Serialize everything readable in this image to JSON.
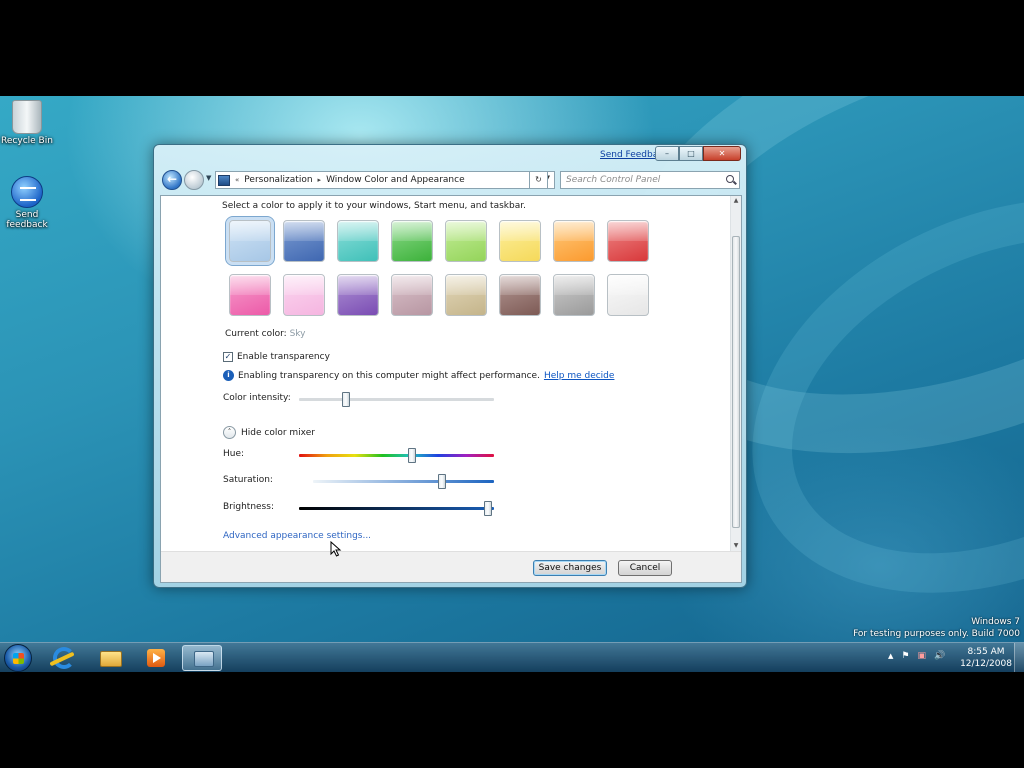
{
  "desktop": {
    "icons": [
      {
        "label": "Recycle Bin",
        "icon": "recycle-bin-icon"
      },
      {
        "label": "Send feedback",
        "icon": "feedback-icon"
      }
    ],
    "watermark": {
      "line1": "Windows 7",
      "line2": "For testing purposes only. Build 7000"
    }
  },
  "window": {
    "send_feedback": "Send Feedback",
    "controls": {
      "minimize": "–",
      "maximize": "□",
      "close": "✕"
    },
    "breadcrumb": {
      "overflow": "«",
      "items": [
        "Personalization",
        "Window Color and Appearance"
      ],
      "separator": "▸"
    },
    "search": {
      "placeholder": "Search Control Panel"
    },
    "instruction": "Select a color to apply it to your windows, Start menu, and taskbar.",
    "swatches": [
      {
        "color": "#cfe3f5",
        "dark": "#a7c7e6",
        "selected": true
      },
      {
        "color": "#7e9ed3",
        "dark": "#3f67b1",
        "selected": false
      },
      {
        "color": "#8fe0db",
        "dark": "#3fc0b8",
        "selected": false
      },
      {
        "color": "#8fdc8c",
        "dark": "#3cb13a",
        "selected": false
      },
      {
        "color": "#c5ee9a",
        "dark": "#94d45a",
        "selected": false
      },
      {
        "color": "#fdf0a0",
        "dark": "#f5d95a",
        "selected": false
      },
      {
        "color": "#ffcc80",
        "dark": "#fb9a2e",
        "selected": false
      },
      {
        "color": "#ef8a8a",
        "dark": "#d8383a",
        "selected": false
      },
      {
        "color": "#f7a0cd",
        "dark": "#ec5aa8",
        "selected": false
      },
      {
        "color": "#fbd7f0",
        "dark": "#f5b5e0",
        "selected": false
      },
      {
        "color": "#b196d6",
        "dark": "#7a4cb3",
        "selected": false
      },
      {
        "color": "#dcc4cc",
        "dark": "#b796a2",
        "selected": false
      },
      {
        "color": "#e4d9bc",
        "dark": "#c4b48a",
        "selected": false
      },
      {
        "color": "#b69a96",
        "dark": "#7d5a55",
        "selected": false
      },
      {
        "color": "#cfcfcf",
        "dark": "#9a9a9a",
        "selected": false
      },
      {
        "color": "#fafafa",
        "dark": "#e6e6e6",
        "selected": false
      }
    ],
    "current_color_label": "Current color:",
    "current_color_value": "Sky",
    "enable_transparency": {
      "label": "Enable transparency",
      "checked": true
    },
    "info": {
      "text": "Enabling transparency on this computer might affect performance.",
      "link": "Help me decide"
    },
    "color_intensity": {
      "label": "Color intensity:",
      "value": 0.24
    },
    "mixer_toggle": "Hide color mixer",
    "hue": {
      "label": "Hue:",
      "value": 0.58
    },
    "saturation": {
      "label": "Saturation:",
      "value": 0.71
    },
    "brightness": {
      "label": "Brightness:",
      "value": 0.97
    },
    "advanced_link": "Advanced appearance settings...",
    "buttons": {
      "save": "Save changes",
      "cancel": "Cancel"
    }
  },
  "taskbar": {
    "clock_time": "8:55 AM",
    "clock_date": "12/12/2008",
    "tray": {
      "arrow": "▲",
      "flag": "⚑",
      "network": "▣",
      "volume": "🔊"
    }
  }
}
